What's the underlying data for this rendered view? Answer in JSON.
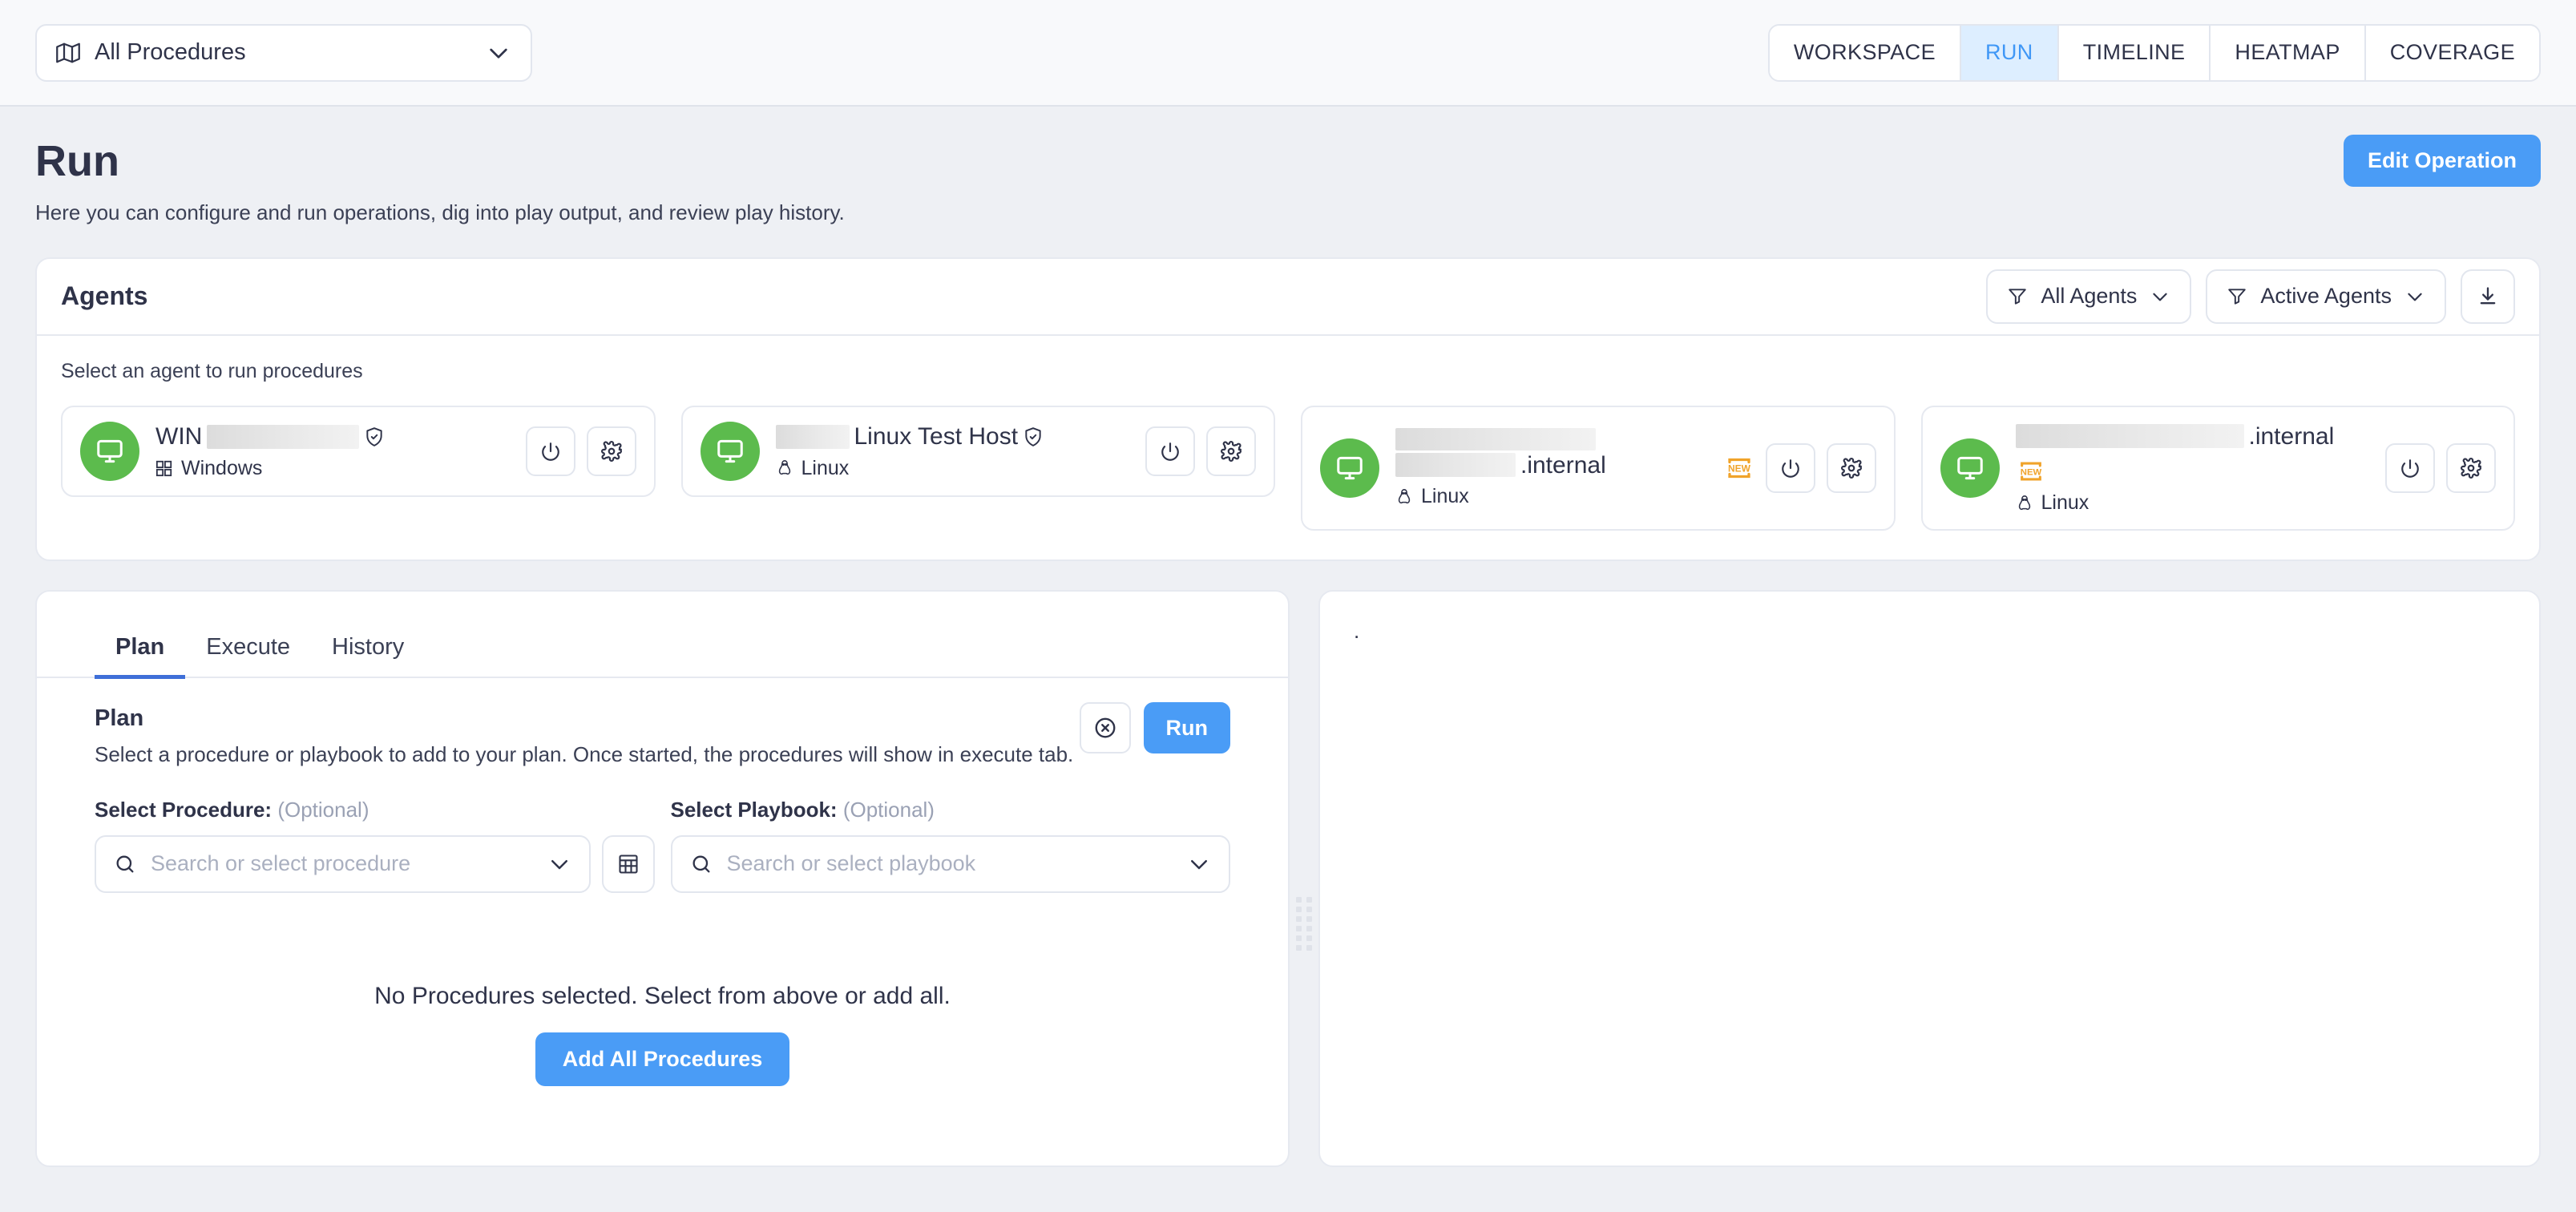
{
  "topbar": {
    "operation_select": {
      "label": "All Procedures",
      "icon": "map-icon",
      "chevron": "chevron-down-icon"
    },
    "nav_tabs": [
      {
        "label": "WORKSPACE",
        "active": false
      },
      {
        "label": "RUN",
        "active": true
      },
      {
        "label": "TIMELINE",
        "active": false
      },
      {
        "label": "HEATMAP",
        "active": false
      },
      {
        "label": "COVERAGE",
        "active": false
      }
    ]
  },
  "page": {
    "title": "Run",
    "subtitle": "Here you can configure and run operations, dig into play output, and review play history.",
    "edit_operation_label": "Edit Operation"
  },
  "agents": {
    "title": "Agents",
    "hint": "Select an agent to run procedures",
    "filter_all": "All Agents",
    "filter_active": "Active Agents",
    "download_icon": "download-icon",
    "list": [
      {
        "name_prefix": "WIN",
        "name_redacted_width": 190,
        "name_suffix": "",
        "trusted": true,
        "os": "Windows",
        "os_icon": "windows-icon",
        "new_badge": false,
        "two_line": false
      },
      {
        "name_prefix": "",
        "name_redacted_width": 92,
        "name_suffix": "Linux Test Host",
        "trusted": true,
        "os": "Linux",
        "os_icon": "linux-icon",
        "new_badge": false,
        "two_line": false
      },
      {
        "name_prefix": "",
        "name_redacted_width": 250,
        "name_suffix": ".internal",
        "trusted": false,
        "os": "Linux",
        "os_icon": "linux-icon",
        "new_badge": true,
        "two_line": true
      },
      {
        "name_prefix": "",
        "name_redacted_width": 285,
        "name_suffix": ".internal",
        "trusted": false,
        "os": "Linux",
        "os_icon": "linux-icon",
        "new_badge": true,
        "two_line": false
      }
    ]
  },
  "tabs": [
    {
      "label": "Plan",
      "active": true
    },
    {
      "label": "Execute",
      "active": false
    },
    {
      "label": "History",
      "active": false
    }
  ],
  "plan": {
    "title": "Plan",
    "description": "Select a procedure or playbook to add to your plan. Once started, the procedures will show in execute tab.",
    "clear_icon": "circle-x-icon",
    "run_label": "Run",
    "procedure_label": "Select Procedure:",
    "procedure_optional": "(Optional)",
    "procedure_placeholder": "Search or select procedure",
    "playbook_label": "Select Playbook:",
    "playbook_optional": "(Optional)",
    "playbook_placeholder": "Search or select playbook",
    "table_view_icon": "table-icon",
    "empty_text": "No Procedures selected. Select from above or add all.",
    "add_all_label": "Add All Procedures"
  },
  "output_panel": {
    "content": "."
  },
  "colors": {
    "accent_blue": "#4a9cf6",
    "tab_active_blue": "#3f97f6",
    "tab_active_bg": "#ddeeff",
    "agent_online_green": "#5cbb4d",
    "new_badge_orange": "#f0a32a",
    "page_bg": "#eef0f4",
    "topbar_bg": "#f8f9fb",
    "text": "#2f3349"
  }
}
